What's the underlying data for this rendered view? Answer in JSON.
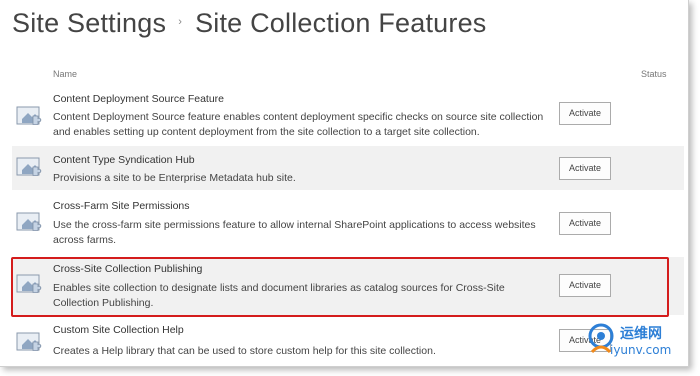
{
  "header": {
    "breadcrumb_root": "Site Settings",
    "separator": "›",
    "page_title": "Site Collection Features"
  },
  "columns": {
    "name": "Name",
    "status": "Status"
  },
  "features": [
    {
      "title": "Content Deployment Source Feature",
      "description": "Content Deployment Source feature enables content deployment specific checks on source site collection and enables setting up content deployment from the site collection to a target site collection.",
      "action": "Activate",
      "highlighted": false
    },
    {
      "title": "Content Type Syndication Hub",
      "description": "Provisions a site to be Enterprise Metadata hub site.",
      "action": "Activate",
      "highlighted": false
    },
    {
      "title": "Cross-Farm Site Permissions",
      "description": "Use the cross-farm site permissions feature to allow internal SharePoint applications to access websites across farms.",
      "action": "Activate",
      "highlighted": false
    },
    {
      "title": "Cross-Site Collection Publishing",
      "description": "Enables site collection to designate lists and document libraries as catalog sources for Cross-Site Collection Publishing.",
      "action": "Activate",
      "highlighted": true
    },
    {
      "title": "Custom Site Collection Help",
      "description": "Creates a Help library that can be used to store custom help for this site collection.",
      "action": "Activate",
      "highlighted": false
    }
  ],
  "watermark": {
    "chinese": "运维网",
    "domain": "iyunv.com"
  },
  "colors": {
    "highlight_border": "#d41c1c",
    "alt_row": "#f1f1f1",
    "watermark_blue": "#2d7fd6"
  }
}
